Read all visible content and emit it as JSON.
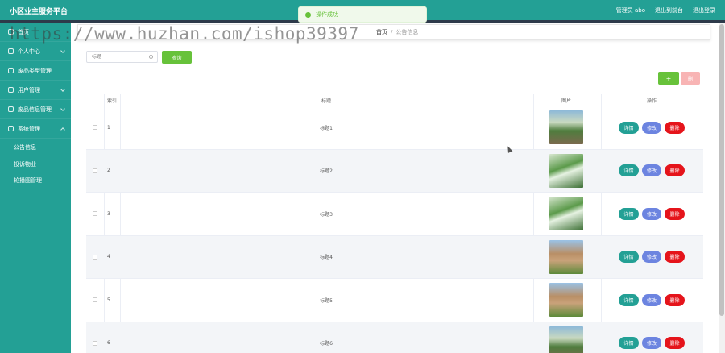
{
  "app": {
    "title": "小区业主服务平台"
  },
  "topbar": {
    "user": "管理员 abo",
    "back_to_front": "退出到前台",
    "logout": "退出登录"
  },
  "toast": {
    "message": "操作成功"
  },
  "watermark": "https://www.huzhan.com/ishop39397",
  "sidebar": {
    "items": [
      {
        "label": "首页"
      },
      {
        "label": "个人中心"
      },
      {
        "label": "废品类型管理"
      },
      {
        "label": "用户管理"
      },
      {
        "label": "废品信息管理"
      },
      {
        "label": "系统管理"
      }
    ],
    "sub_items": [
      {
        "label": "公告信息"
      },
      {
        "label": "投诉物业"
      },
      {
        "label": "轮播图管理"
      }
    ]
  },
  "breadcrumb": {
    "home": "首页",
    "separator": "/",
    "current": "公告信息"
  },
  "search": {
    "placeholder": "标题",
    "button": "查询"
  },
  "actions": {
    "add": "+",
    "delete": "删"
  },
  "table": {
    "headers": {
      "index": "索引",
      "title": "标题",
      "image": "图片",
      "actions": "操作"
    },
    "row_buttons": {
      "detail": "详情",
      "edit": "修改",
      "remove": "删除"
    },
    "rows": [
      {
        "index": "1",
        "title": "标题1",
        "image": "street-photo"
      },
      {
        "index": "2",
        "title": "标题2",
        "image": "people-photo"
      },
      {
        "index": "3",
        "title": "标题3",
        "image": "people-photo"
      },
      {
        "index": "4",
        "title": "标题4",
        "image": "building-photo"
      },
      {
        "index": "5",
        "title": "标题5",
        "image": "building-photo"
      },
      {
        "index": "6",
        "title": "标题6",
        "image": "street-photo"
      }
    ]
  },
  "colors": {
    "primary": "#23a095",
    "success": "#67c23a",
    "danger": "#e5141b",
    "edit": "#6c84e0"
  }
}
